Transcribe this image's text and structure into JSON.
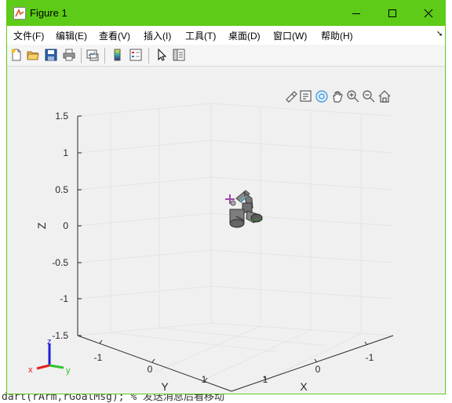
{
  "window": {
    "title": "Figure 1"
  },
  "menu": [
    {
      "label": "文件(F)"
    },
    {
      "label": "编辑(E)"
    },
    {
      "label": "查看(V)"
    },
    {
      "label": "插入(I)"
    },
    {
      "label": "工具(T)"
    },
    {
      "label": "桌面(D)"
    },
    {
      "label": "窗口(W)"
    },
    {
      "label": "帮助(H)"
    }
  ],
  "toolbar": [
    "new-figure-icon",
    "open-file-icon",
    "save-icon",
    "print-icon",
    "link-plot-icon",
    "insert-colorbar-icon",
    "insert-legend-icon",
    "pointer-icon",
    "property-inspector-icon"
  ],
  "axes_toolbar": [
    "brush-icon",
    "data-tips-icon",
    "rotate-3d-icon",
    "pan-icon",
    "zoom-in-icon",
    "zoom-out-icon",
    "home-icon"
  ],
  "plot": {
    "z_label": "Z",
    "x_label": "X",
    "y_label": "Y",
    "z_ticks": [
      "1.5",
      "1",
      "0.5",
      "0",
      "-0.5",
      "-1",
      "-1.5"
    ],
    "x_ticks": [
      "1",
      "0",
      "-1"
    ],
    "y_ticks": [
      "-1",
      "0",
      "1"
    ],
    "triad": {
      "z": "z",
      "y": "y",
      "x": "x"
    }
  },
  "background_code": "dart(rArm,rGoalMsg); % 发送消息后看移动"
}
